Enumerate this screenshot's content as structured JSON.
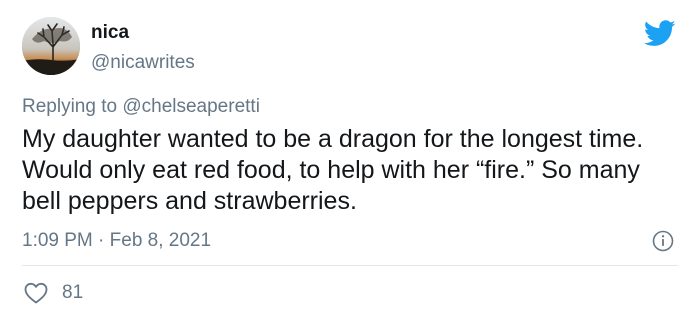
{
  "author": {
    "display_name": "nica",
    "handle": "@nicawrites",
    "avatar_icon": "tree-sunset-photo"
  },
  "reply": {
    "prefix": "Replying to ",
    "mention": "@chelseaperetti"
  },
  "tweet": {
    "text": "My daughter wanted to be a dragon for the longest time. Would only eat red food, to help with her “fire.” So many bell peppers and strawberries.",
    "time": "1:09 PM",
    "separator": " · ",
    "date": "Feb 8, 2021"
  },
  "engagement": {
    "likes": "81",
    "like_icon": "heart-icon"
  },
  "colors": {
    "brand": "#1da1f2",
    "text": "#14171a",
    "secondary": "#657786",
    "divider": "#e1e8ed"
  }
}
